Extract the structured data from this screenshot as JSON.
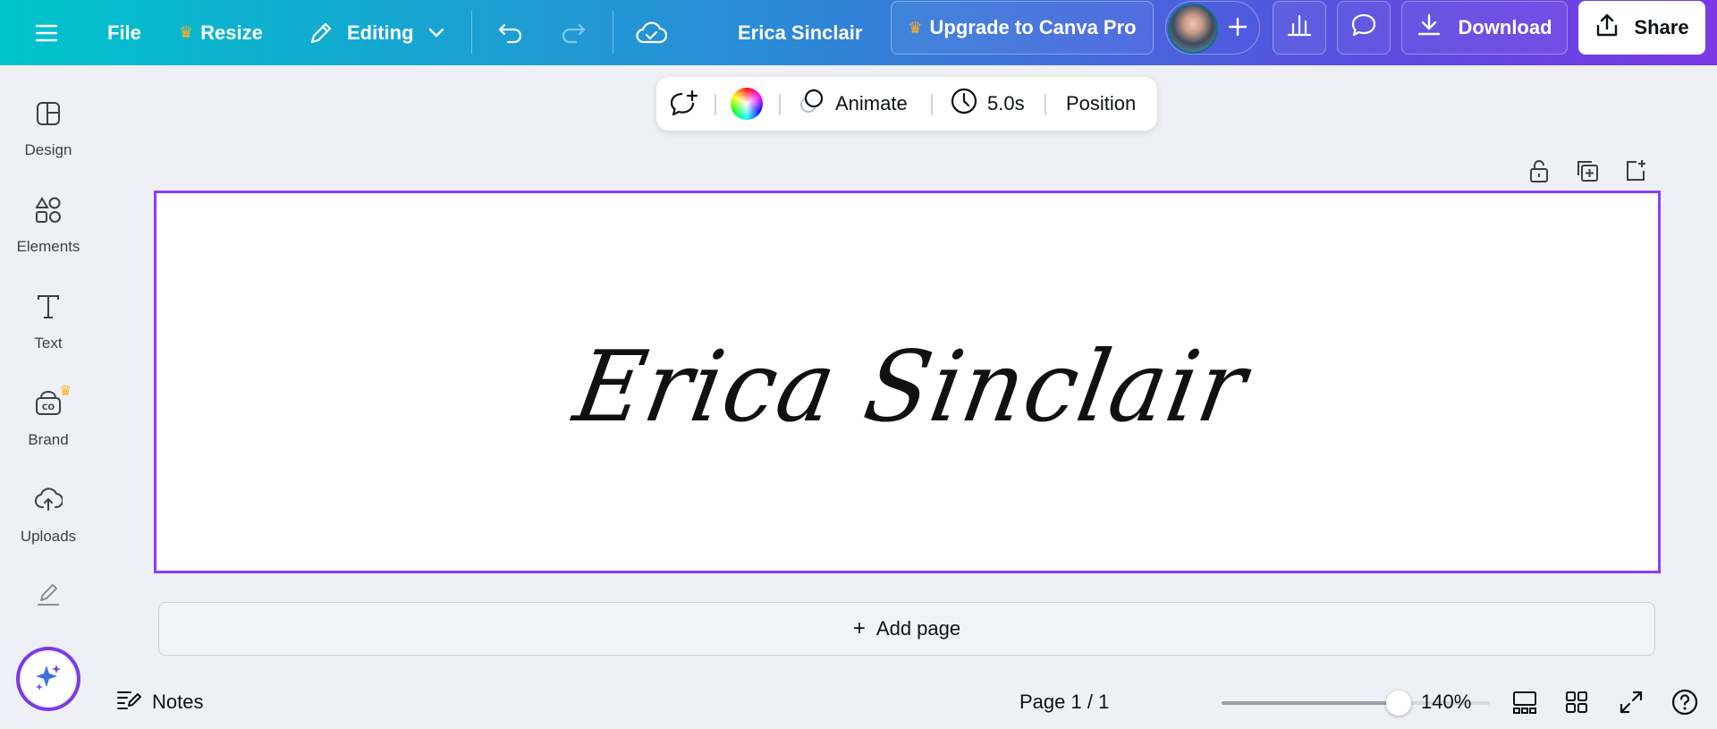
{
  "topbar": {
    "menu_icon": "hamburger-icon",
    "file_label": "File",
    "resize_label": "Resize",
    "editing_label": "Editing",
    "doc_title": "Erica Sinclair",
    "upgrade_label": "Upgrade to Canva Pro",
    "download_label": "Download",
    "share_label": "Share"
  },
  "floating_toolbar": {
    "animate_label": "Animate",
    "duration_label": "5.0s",
    "position_label": "Position"
  },
  "sidebar": {
    "items": [
      {
        "label": "Design",
        "icon": "design-icon"
      },
      {
        "label": "Elements",
        "icon": "elements-icon"
      },
      {
        "label": "Text",
        "icon": "text-icon"
      },
      {
        "label": "Brand",
        "icon": "brand-icon"
      },
      {
        "label": "Uploads",
        "icon": "uploads-icon"
      }
    ]
  },
  "canvas": {
    "signature_text": "Erica Sinclair"
  },
  "add_page_label": "Add page",
  "bottombar": {
    "notes_label": "Notes",
    "page_indicator": "Page 1 / 1",
    "zoom_label": "140%",
    "zoom_slider_fraction": 0.66
  },
  "colors": {
    "accent": "#8b3dff",
    "crown": "#ffb020"
  }
}
